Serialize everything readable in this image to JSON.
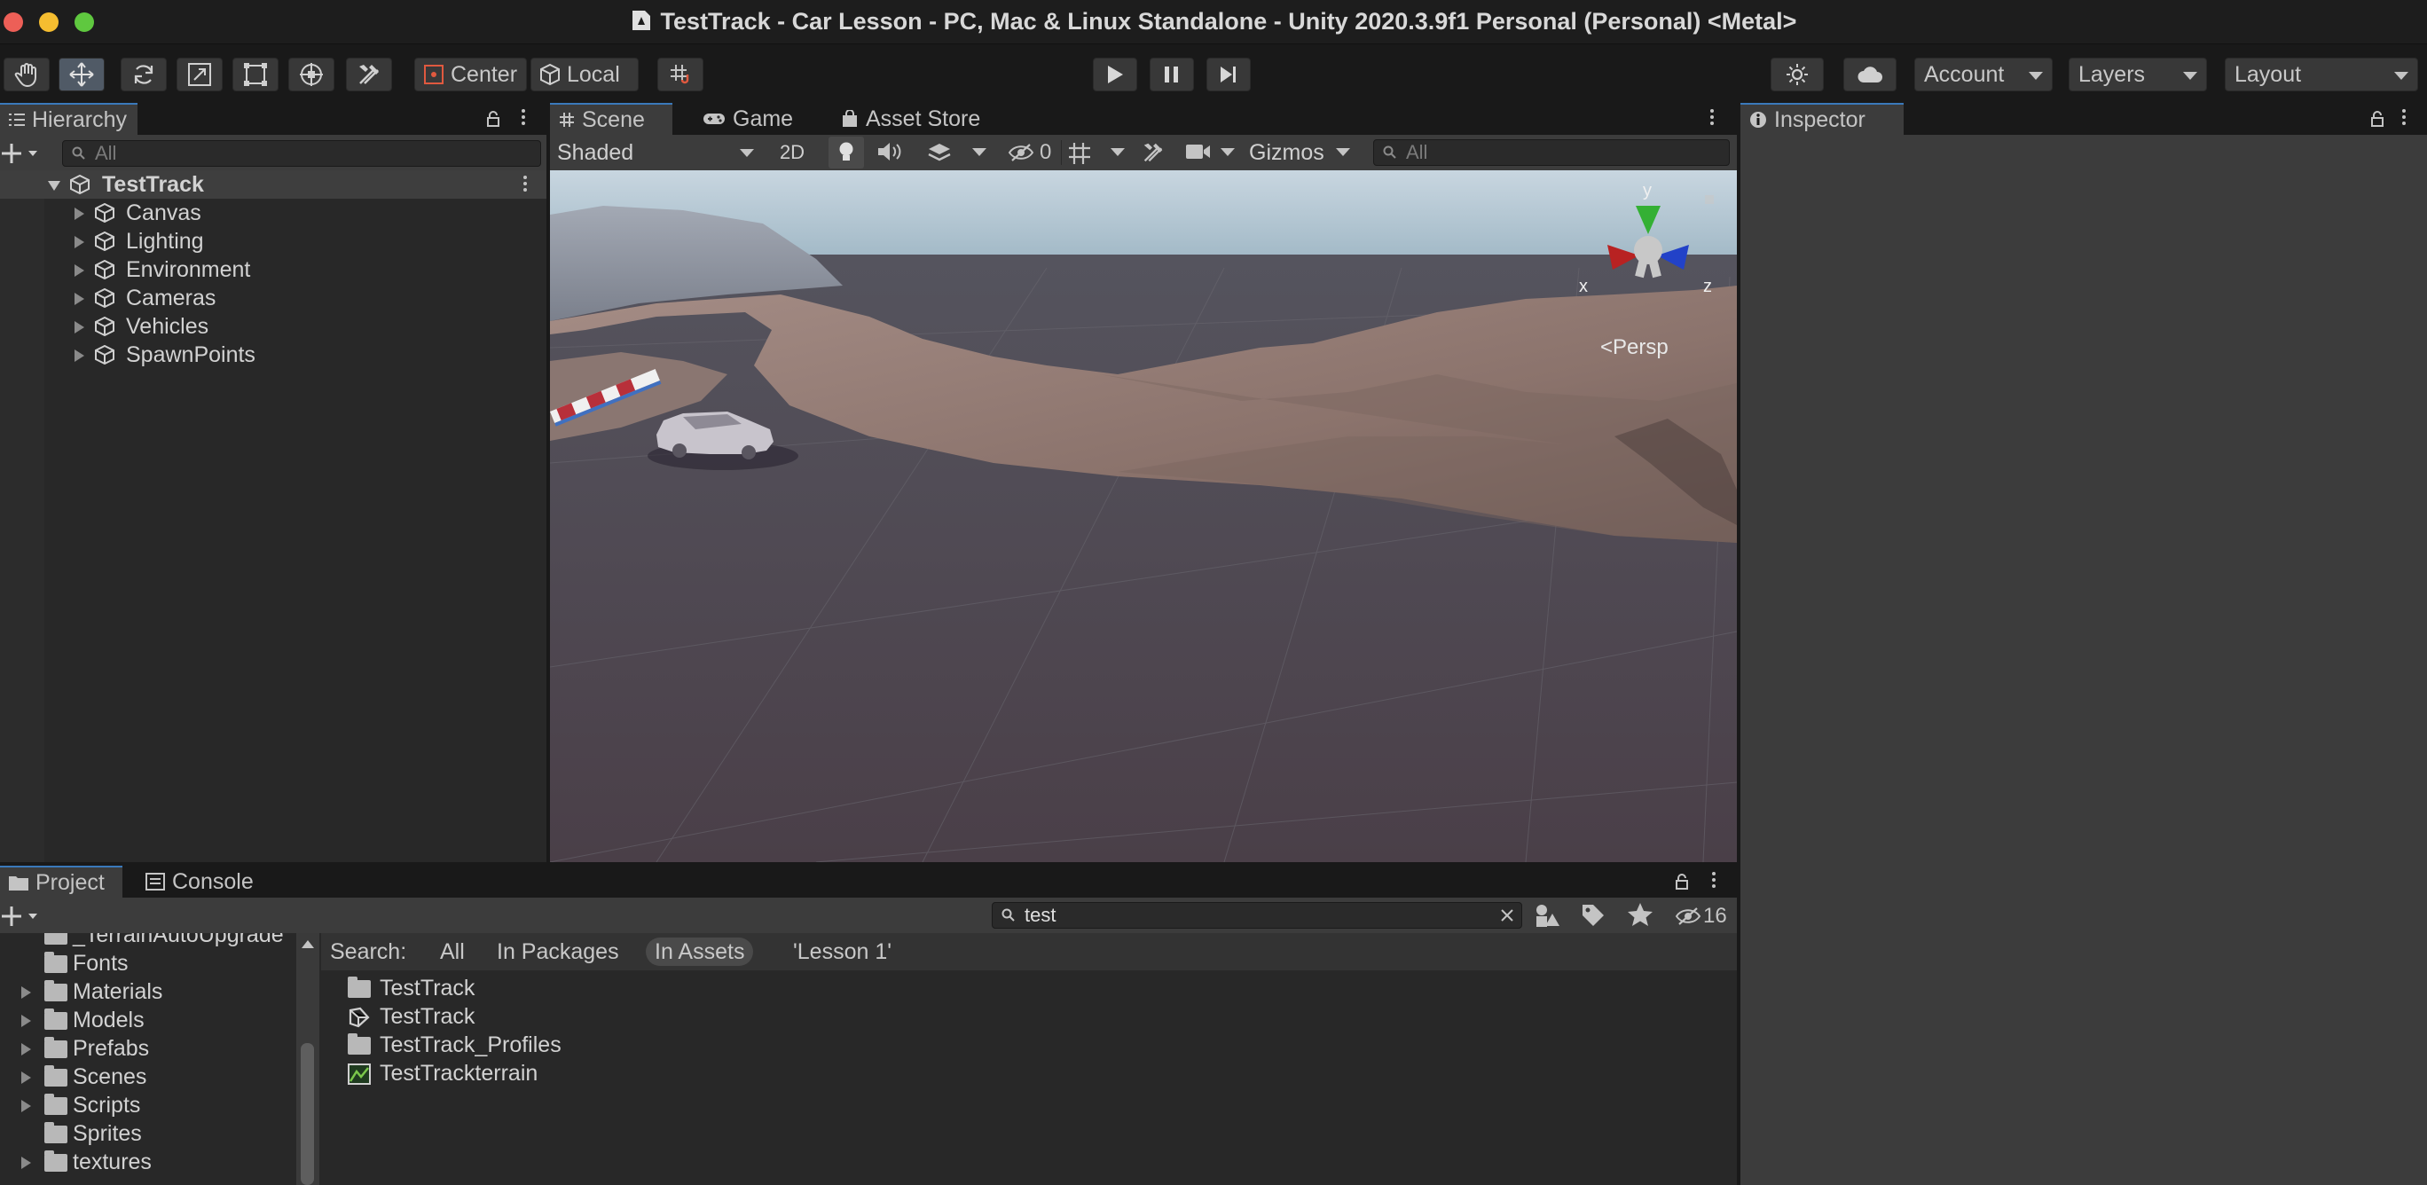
{
  "window": {
    "title": "TestTrack - Car Lesson - PC, Mac & Linux Standalone - Unity 2020.3.9f1 Personal (Personal) <Metal>"
  },
  "toolbar": {
    "tools": [
      "hand-tool",
      "move-tool",
      "rotate-tool",
      "scale-tool",
      "rect-tool",
      "transform-tool",
      "custom-tool"
    ],
    "pivot_label": "Center",
    "space_label": "Local",
    "account_label": "Account",
    "layers_label": "Layers",
    "layout_label": "Layout"
  },
  "hierarchy": {
    "tab_label": "Hierarchy",
    "search_placeholder": "All",
    "scene_name": "TestTrack",
    "items": [
      "Canvas",
      "Lighting",
      "Environment",
      "Cameras",
      "Vehicles",
      "SpawnPoints"
    ]
  },
  "scene_view": {
    "tabs": [
      "Scene",
      "Game",
      "Asset Store"
    ],
    "draw_mode": "Shaded",
    "mode_2d": "2D",
    "hidden_count": "0",
    "gizmos_label": "Gizmos",
    "search_placeholder": "All",
    "gizmo_axes": {
      "x": "x",
      "y": "y",
      "z": "z"
    },
    "projection_label": "<Persp",
    "colors": {
      "sky_top": "#b9cad6",
      "ground": "#4a4450",
      "terrain": "#8a7570",
      "gizmo_x": "#c02020",
      "gizmo_y": "#30c030",
      "gizmo_z": "#2040d0"
    }
  },
  "inspector": {
    "tab_label": "Inspector"
  },
  "project": {
    "tabs": [
      "Project",
      "Console"
    ],
    "search_value": "test",
    "hidden_count": "16",
    "search_label": "Search:",
    "filters": [
      "All",
      "In Packages",
      "In Assets",
      "'Lesson 1'"
    ],
    "active_filter": "In Assets",
    "tree": [
      {
        "label": "_TerrainAutoUpgrade",
        "expandable": false
      },
      {
        "label": "Fonts",
        "expandable": false
      },
      {
        "label": "Materials",
        "expandable": true
      },
      {
        "label": "Models",
        "expandable": true
      },
      {
        "label": "Prefabs",
        "expandable": true
      },
      {
        "label": "Scenes",
        "expandable": true
      },
      {
        "label": "Scripts",
        "expandable": true
      },
      {
        "label": "Sprites",
        "expandable": false
      },
      {
        "label": "textures",
        "expandable": true
      }
    ],
    "results": [
      {
        "label": "TestTrack",
        "icon": "folder-icon"
      },
      {
        "label": "TestTrack",
        "icon": "unity-scene-icon"
      },
      {
        "label": "TestTrack_Profiles",
        "icon": "folder-icon"
      },
      {
        "label": "TestTrackterrain",
        "icon": "terrain-asset-icon"
      }
    ]
  }
}
